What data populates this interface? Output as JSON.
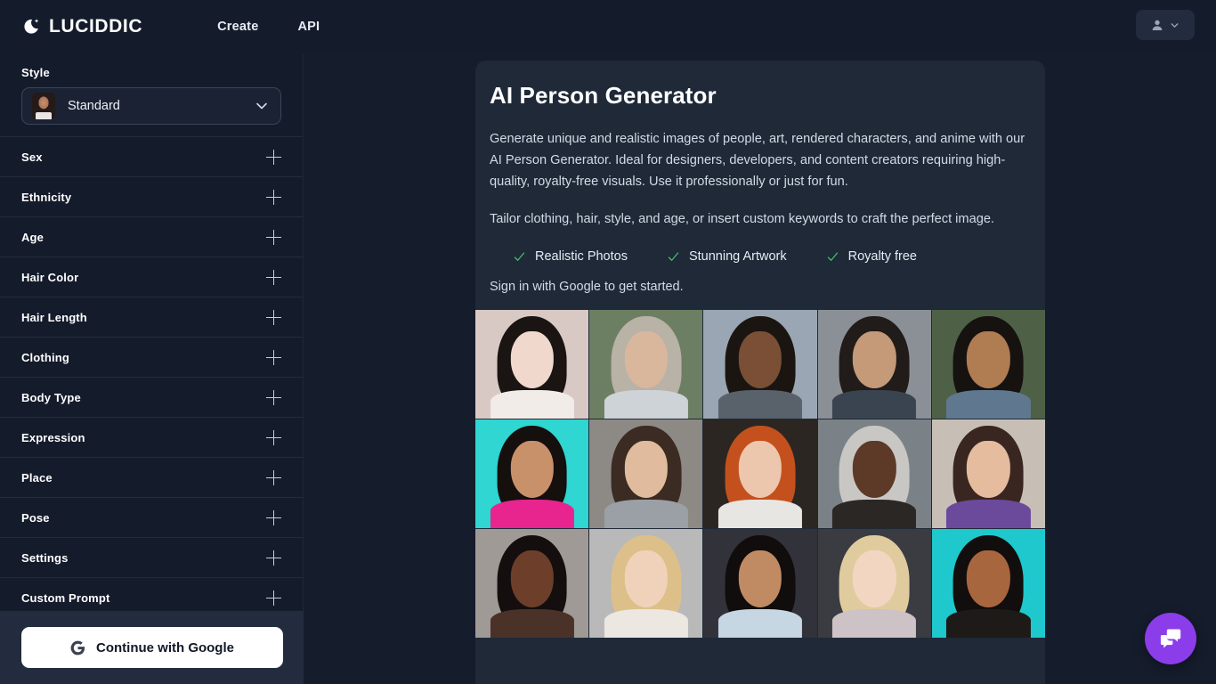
{
  "header": {
    "brand_name": "LUCIDDIC",
    "logo_icon": "crescent-moon-sparkle-icon",
    "nav": [
      {
        "label": "Create"
      },
      {
        "label": "API"
      }
    ],
    "account": {
      "person_icon": "person-icon",
      "chevron_icon": "chevron-down-icon"
    }
  },
  "sidebar": {
    "style": {
      "label": "Style",
      "selected": "Standard",
      "thumb_icon": "style-thumbnail",
      "chevron_icon": "chevron-down-icon"
    },
    "accordions": [
      {
        "label": "Sex",
        "plus_icon": "plus-icon"
      },
      {
        "label": "Ethnicity",
        "plus_icon": "plus-icon"
      },
      {
        "label": "Age",
        "plus_icon": "plus-icon"
      },
      {
        "label": "Hair Color",
        "plus_icon": "plus-icon"
      },
      {
        "label": "Hair Length",
        "plus_icon": "plus-icon"
      },
      {
        "label": "Clothing",
        "plus_icon": "plus-icon"
      },
      {
        "label": "Body Type",
        "plus_icon": "plus-icon"
      },
      {
        "label": "Expression",
        "plus_icon": "plus-icon"
      },
      {
        "label": "Place",
        "plus_icon": "plus-icon"
      },
      {
        "label": "Pose",
        "plus_icon": "plus-icon"
      },
      {
        "label": "Settings",
        "plus_icon": "plus-icon"
      },
      {
        "label": "Custom Prompt",
        "plus_icon": "plus-icon"
      }
    ],
    "auth": {
      "google_button_label": "Continue with Google",
      "google_icon": "google-g-icon"
    }
  },
  "main": {
    "title": "AI Person Generator",
    "paragraph_1": "Generate unique and realistic images of people, art, rendered characters, and anime with our AI Person Generator. Ideal for designers, developers, and content creators requiring high-quality, royalty-free visuals. Use it professionally or just for fun.",
    "paragraph_2": "Tailor clothing, hair, style, and age, or insert custom keywords to craft the perfect image.",
    "features": [
      {
        "label": "Realistic Photos",
        "icon": "check-icon"
      },
      {
        "label": "Stunning Artwork",
        "icon": "check-icon"
      },
      {
        "label": "Royalty free",
        "icon": "check-icon"
      }
    ],
    "signin_note": "Sign in with Google to get started.",
    "gallery": {
      "rows": 3,
      "columns": 5,
      "tiles": [
        {
          "alt": "asian-woman-white-lace-dress",
          "bg": "#d9c9c4",
          "hair": "#1a1513",
          "skin": "#f0d8cc",
          "torso": "#f2ece8"
        },
        {
          "alt": "older-man-grey-beard-suit",
          "bg": "#6d7f63",
          "hair": "#b9b2a6",
          "skin": "#d9b79c",
          "torso": "#cdd3d6"
        },
        {
          "alt": "black-man-in-suit-and-tie",
          "bg": "#9aa6b4",
          "hair": "#1b1512",
          "skin": "#7a4f35",
          "torso": "#59616b"
        },
        {
          "alt": "older-asian-man-dark-shirt",
          "bg": "#8b9097",
          "hair": "#211c19",
          "skin": "#c49a79",
          "torso": "#3a4450"
        },
        {
          "alt": "young-indian-man-blue-shirt",
          "bg": "#4e6046",
          "hair": "#161210",
          "skin": "#b07c52",
          "torso": "#5f7890"
        },
        {
          "alt": "woman-colorful-makeup-neon-bg",
          "bg": "#2fd6d2",
          "hair": "#150f0e",
          "skin": "#c9916a",
          "torso": "#e8248f"
        },
        {
          "alt": "asian-woman-grey-blazer",
          "bg": "#8d8a86",
          "hair": "#3b2b23",
          "skin": "#e0bb9d",
          "torso": "#9aa0a5"
        },
        {
          "alt": "redhead-woman-bokeh-lights",
          "bg": "#2b2622",
          "hair": "#c4511d",
          "skin": "#edc6ae",
          "torso": "#e8e6e3"
        },
        {
          "alt": "older-black-man-grey-hair",
          "bg": "#7b8287",
          "hair": "#c9c7c4",
          "skin": "#5c3a27",
          "torso": "#2b2724"
        },
        {
          "alt": "woman-purple-jacket-indoors",
          "bg": "#c7bfb6",
          "hair": "#3a2620",
          "skin": "#e5bc9e",
          "torso": "#6b4a9c"
        },
        {
          "alt": "black-woman-curly-hair-portrait",
          "bg": "#a09a96",
          "hair": "#140f0e",
          "skin": "#6d3f2a",
          "torso": "#4a3228"
        },
        {
          "alt": "blonde-woman-white-top",
          "bg": "#b9b9b9",
          "hair": "#ddc089",
          "skin": "#f0d2bb",
          "torso": "#ece7e0"
        },
        {
          "alt": "man-light-blue-shirt-seated",
          "bg": "#31323a",
          "hair": "#100d0c",
          "skin": "#c08b63",
          "torso": "#c6d6e3"
        },
        {
          "alt": "blonde-woman-knit-scarf",
          "bg": "#3a3c42",
          "hair": "#e0cb9e",
          "skin": "#f3d6c2",
          "torso": "#cdc2c6"
        },
        {
          "alt": "two-people-traditional-outfit-teal-bg",
          "bg": "#1ec8cd",
          "hair": "#120e0d",
          "skin": "#a8663f",
          "torso": "#1d1a18"
        }
      ]
    }
  },
  "chat_widget": {
    "icon": "chat-bubbles-icon",
    "color": "#8b3dea"
  },
  "theme": {
    "page_bg": "#151c2c",
    "sidebar_bg": "#141b2b",
    "panel_bg": "#1f2937",
    "accent_check": "#3fbf6a",
    "auth_panel_bg": "#222c3e"
  }
}
